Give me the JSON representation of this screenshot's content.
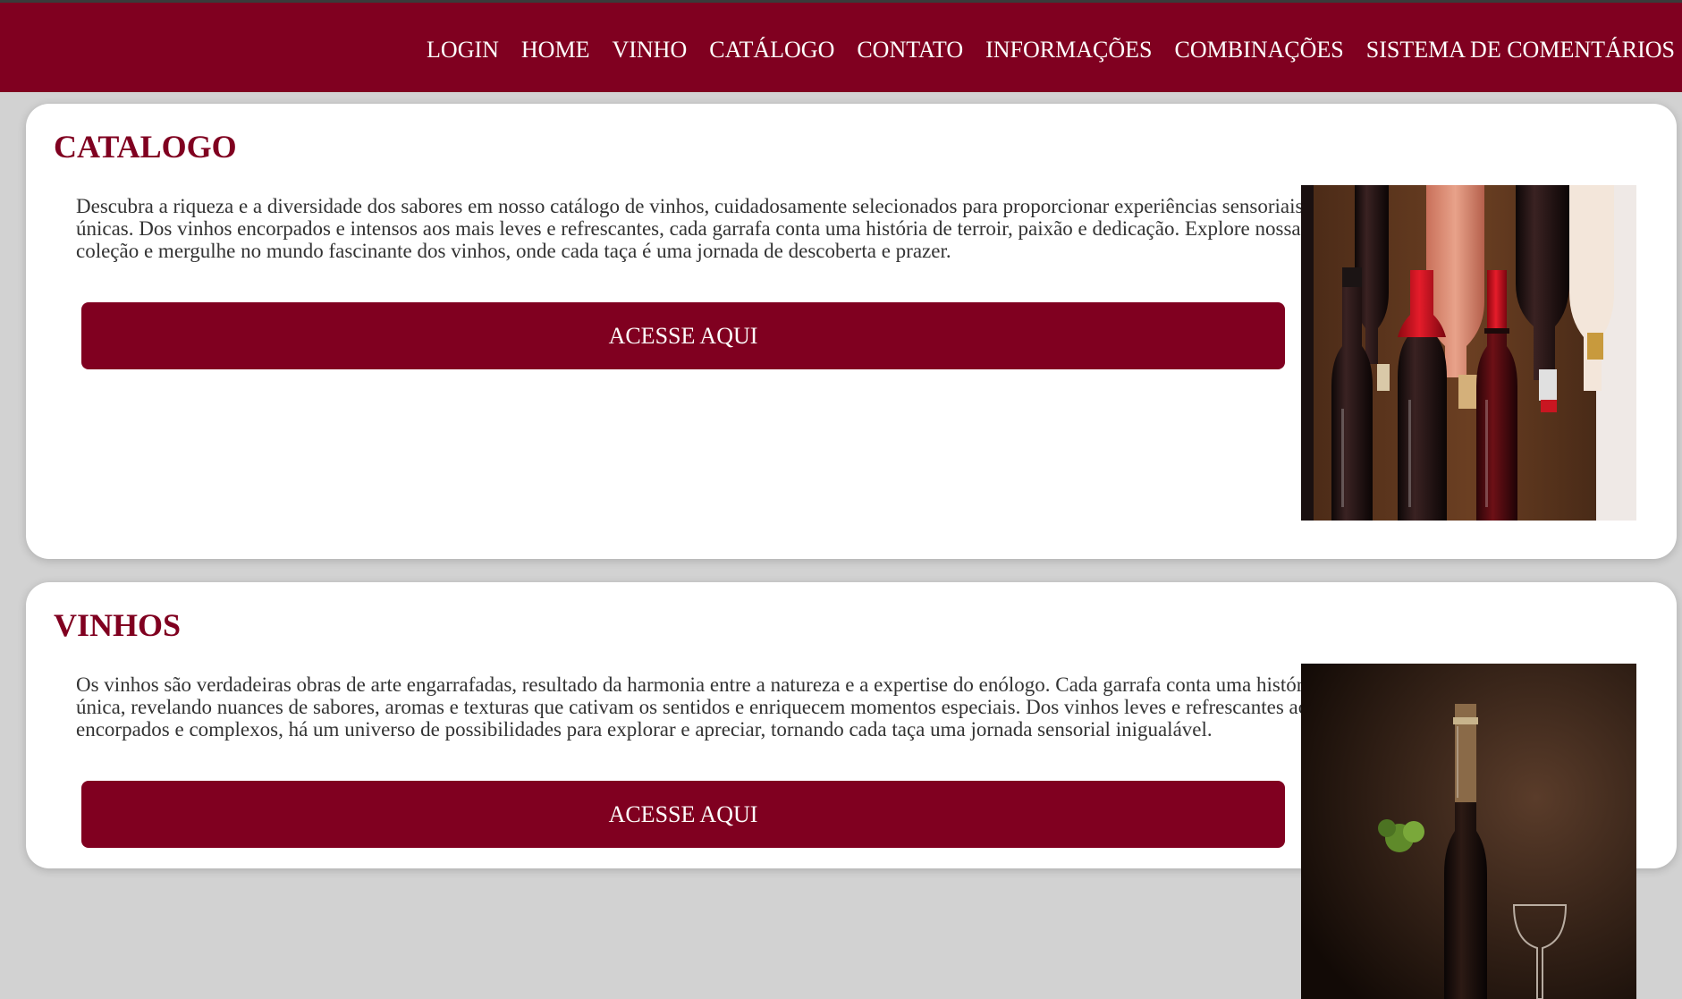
{
  "nav": {
    "items": [
      {
        "label": "LOGIN"
      },
      {
        "label": "HOME"
      },
      {
        "label": "VINHO"
      },
      {
        "label": "CATÁLOGO"
      },
      {
        "label": "CONTATO"
      },
      {
        "label": "INFORMAÇÕES"
      },
      {
        "label": "COMBINAÇÕES"
      },
      {
        "label": "SISTEMA DE COMENTÁRIOS"
      }
    ]
  },
  "colors": {
    "brand": "#800020",
    "page_bg": "#d2d2d2",
    "card_bg": "#ffffff",
    "text": "#333333"
  },
  "sections": [
    {
      "title": "CATALOGO",
      "text": "Descubra a riqueza e a diversidade dos sabores em nosso catálogo de vinhos, cuidadosamente selecionados para proporcionar experiências sensoriais únicas. Dos vinhos encorpados e intensos aos mais leves e refrescantes, cada garrafa conta uma história de terroir, paixão e dedicação. Explore nossa coleção e mergulhe no mundo fascinante dos vinhos, onde cada taça é uma jornada de descoberta e prazer.",
      "button": "ACESSE AQUI",
      "image": "wine-bottles-photo"
    },
    {
      "title": "VINHOS",
      "text": "Os vinhos são verdadeiras obras de arte engarrafadas, resultado da harmonia entre a natureza e a expertise do enólogo. Cada garrafa conta uma história única, revelando nuances de sabores, aromas e texturas que cativam os sentidos e enriquecem momentos especiais. Dos vinhos leves e refrescantes aos encorpados e complexos, há um universo de possibilidades para explorar e apreciar, tornando cada taça uma jornada sensorial inigualável.",
      "button": "ACESSE AQUI",
      "image": "wine-bottle-glass-photo"
    }
  ]
}
